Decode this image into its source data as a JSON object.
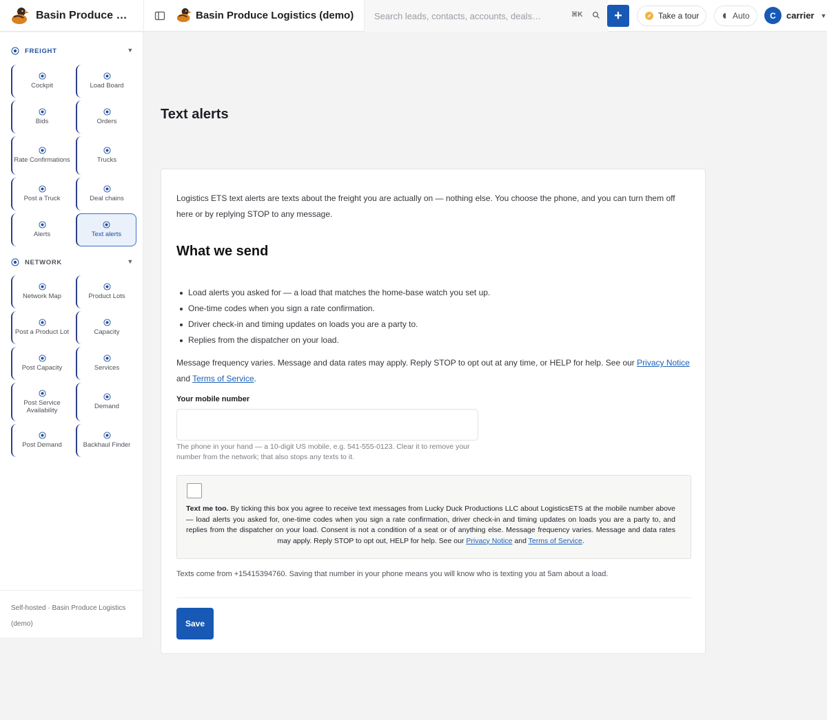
{
  "topbar": {
    "sidebar_brand": "Basin Produce L…",
    "app_title": "Basin Produce Logistics (demo)",
    "search_placeholder": "Search leads, contacts, accounts, deals…",
    "search_shortcut": "⌘K",
    "add_label": "+",
    "tour_label": "Take a tour",
    "theme_label": "Auto",
    "user_initial": "C",
    "user_name": "carrier"
  },
  "sidebar": {
    "freight": {
      "title": "FREIGHT",
      "items": [
        {
          "label": "Cockpit"
        },
        {
          "label": "Load Board"
        },
        {
          "label": "Bids"
        },
        {
          "label": "Orders"
        },
        {
          "label": "Rate Confirmations"
        },
        {
          "label": "Trucks"
        },
        {
          "label": "Post a Truck"
        },
        {
          "label": "Deal chains"
        },
        {
          "label": "Alerts"
        },
        {
          "label": "Text alerts"
        }
      ]
    },
    "network": {
      "title": "NETWORK",
      "items": [
        {
          "label": "Network Map"
        },
        {
          "label": "Product Lots"
        },
        {
          "label": "Post a Product Lot"
        },
        {
          "label": "Capacity"
        },
        {
          "label": "Post Capacity"
        },
        {
          "label": "Services"
        },
        {
          "label": "Post Service Availability"
        },
        {
          "label": "Demand"
        },
        {
          "label": "Post Demand"
        },
        {
          "label": "Backhaul Finder"
        }
      ]
    },
    "footer": "Self-hosted · Basin Produce Logistics (demo)"
  },
  "main": {
    "title": "Text alerts",
    "intro": "Logistics ETS text alerts are texts about the freight you are actually on — nothing else. You choose the phone, and you can turn them off here or by replying STOP to any message.",
    "section_heading": "What we send",
    "bullets": [
      "Load alerts you asked for — a load that matches the home-base watch you set up.",
      "One-time codes when you sign a rate confirmation.",
      "Driver check-in and timing updates on loads you are a party to.",
      "Replies from the dispatcher on your load."
    ],
    "frequency_text": "Message frequency varies. Message and data rates may apply. Reply STOP to opt out at any time, or HELP for help. See our",
    "privacy_link": "Privacy Notice",
    "and_word": "and",
    "terms_link": "Terms of Service",
    "period": ".",
    "phone_label": "Your mobile number",
    "phone_value": "",
    "phone_hint": "The phone in your hand — a 10-digit US mobile, e.g. 541-555-0123. Clear it to remove your number from the network; that also stops any texts to it.",
    "consent_lead": "Text me too.",
    "consent_body": "By ticking this box you agree to receive text messages from Lucky Duck Productions LLC about LogisticsETS at the mobile number above — load alerts you asked for, one-time codes when you sign a rate confirmation, driver check-in and timing updates on loads you are a party to, and replies from the dispatcher on your load. Consent is not a condition of a seat or of anything else. Message frequency varies. Message and data rates may apply. Reply STOP to opt out, HELP for help. See our",
    "consent_checked": false,
    "from_text": "Texts come from +15415394760. Saving that number in your phone means you will know who is texting you at 5am about a load.",
    "save_label": "Save"
  },
  "colors": {
    "accent": "#1759b5",
    "tile_border": "#2b3f8c",
    "active_tile_bg": "#eaf1fb"
  },
  "icons": {
    "brand": "duck-logo-icon",
    "panel": "sidebar-toggle-icon",
    "search": "search-icon",
    "tour": "compass-icon",
    "theme": "half-moon-icon",
    "nav": "radio-target-icon"
  }
}
